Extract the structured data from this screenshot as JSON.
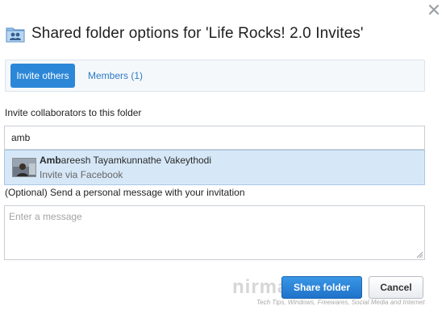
{
  "dialog": {
    "title": "Shared folder options for 'Life Rocks! 2.0 Invites'",
    "close_icon": "close-icon",
    "folder_icon": "shared-folder-icon"
  },
  "tabs": [
    {
      "label": "Invite others",
      "active": true
    },
    {
      "label": "Members (1)",
      "active": false
    }
  ],
  "invite": {
    "label": "Invite collaborators to this folder",
    "input_value": "amb"
  },
  "suggestion": {
    "name_match": "Amb",
    "name_rest": "areesh Tayamkunnathe Vakeythodi",
    "subtitle": "Invite via Facebook",
    "avatar_icon": "user-avatar"
  },
  "message": {
    "label": "(Optional) Send a personal message with your invitation",
    "placeholder": "Enter a message",
    "value": ""
  },
  "buttons": {
    "share_label": "Share folder",
    "cancel_label": "Cancel"
  },
  "watermark": {
    "logo_text": "nirmaltv.com",
    "tagline": "Tech Tips, Windows, Freewares, Social Media and Internet"
  },
  "colors": {
    "accent": "#2c87d8",
    "suggestion_bg": "#d6e8f8",
    "tab_bar_bg": "#f5f8fb"
  }
}
